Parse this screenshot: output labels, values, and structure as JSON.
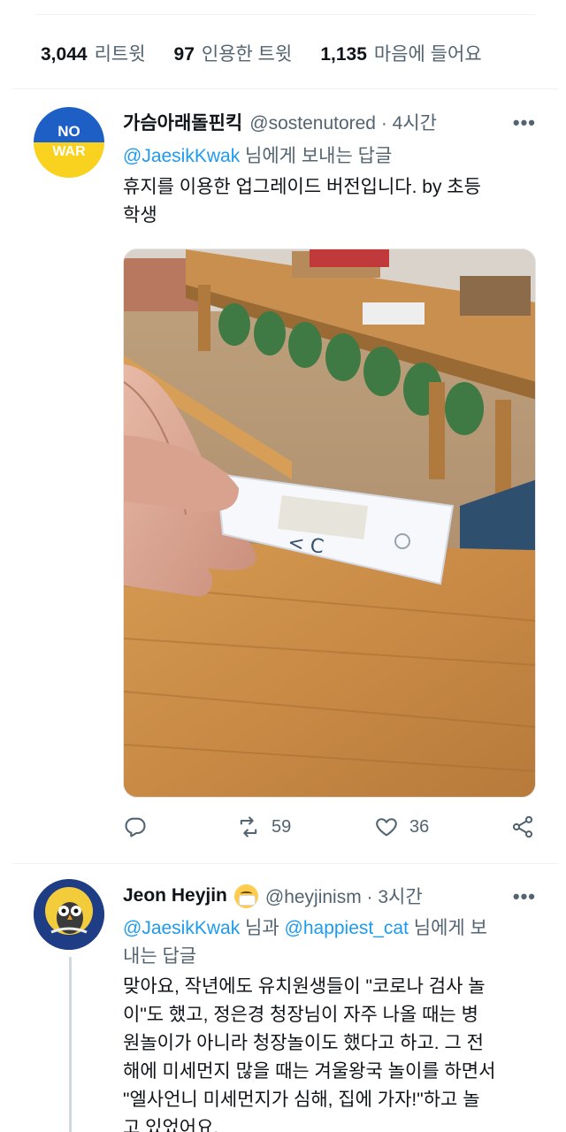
{
  "stats": {
    "retweets": {
      "count": "3,044",
      "label": "리트윗"
    },
    "quotes": {
      "count": "97",
      "label": "인용한 트윗"
    },
    "likes": {
      "count": "1,135",
      "label": "마음에 들어요"
    }
  },
  "tweet1": {
    "avatar_text_1": "NO",
    "avatar_text_2": "WAR",
    "name": "가슴아래돌핀킥",
    "handle": "@sostenutored · 4시간",
    "more": "•••",
    "reply_link": "@JaesikKwak",
    "reply_suffix": " 님에게 보내는 답글",
    "text_line1": "휴지를 이용한 업그레이드 버전입니다. by 초등",
    "text_line2": "학생",
    "photo_marks": "< C",
    "actions": {
      "reply_icon": "reply-icon",
      "retweet_count": "59",
      "like_count": "36",
      "share_icon": "share-icon"
    }
  },
  "tweet2": {
    "name": "Jeon Heyjin",
    "emoji": "mask-face-emoji",
    "handle": "@heyjinism · 3시간",
    "more": "•••",
    "reply_link1": "@JaesikKwak",
    "reply_mid": " 님과 ",
    "reply_link2": "@happiest_cat",
    "reply_suffix1": " 님에게 보",
    "reply_line2": "내는 답글",
    "lines": [
      "맞아요, 작년에도 유치원생들이 \"코로나 검사 놀",
      "이\"도 했고, 정은경 청장님이 자주 나올 때는 병",
      "원놀이가 아니라 청장놀이도 했다고 하고. 그 전",
      "해에 미세먼지 많을 때는 겨울왕국 놀이를 하면서",
      "\"엘사언니 미세먼지가 심해, 집에 가자!\"하고 놀",
      "고 있었어요."
    ]
  },
  "colors": {
    "link": "#1d9bf0",
    "secondary": "#536471",
    "text": "#0f1419"
  }
}
